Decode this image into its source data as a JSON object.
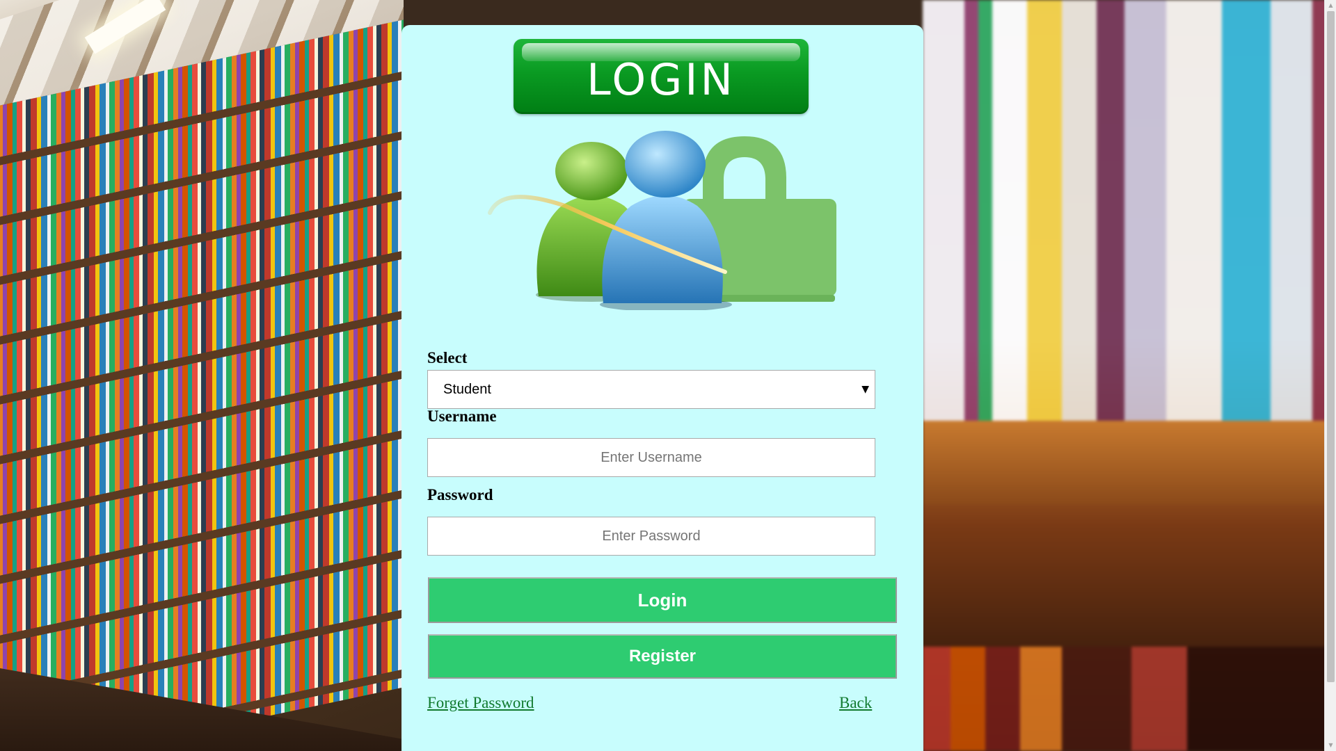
{
  "banner": {
    "text": "LOGIN"
  },
  "form": {
    "select_label": "Select",
    "select_value": "Student",
    "username_label": "Username",
    "username_placeholder": "Enter Username",
    "password_label": "Password",
    "password_placeholder": "Enter Password"
  },
  "buttons": {
    "login": "Login",
    "register": "Register"
  },
  "links": {
    "forget_password": "Forget Password",
    "back": "Back"
  },
  "colors": {
    "panel": "#c8fdfd",
    "button": "#2ecc71",
    "banner": "#0a9a22",
    "link": "#117a2e"
  }
}
